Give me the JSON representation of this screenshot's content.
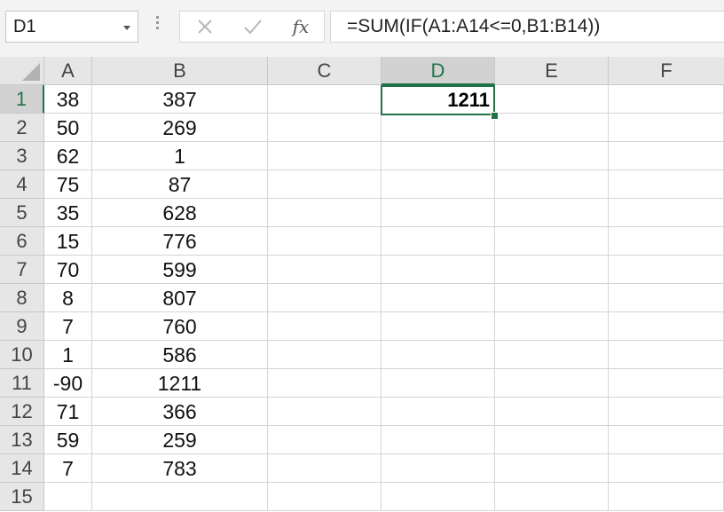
{
  "formula_bar": {
    "name_box": "D1",
    "formula": "=SUM(IF(A1:A14<=0,B1:B14))",
    "function_label": "fx",
    "icons": {
      "cancel": "close-icon",
      "enter": "check-icon",
      "function": "fx-icon"
    }
  },
  "columns": [
    "A",
    "B",
    "C",
    "D",
    "E",
    "F"
  ],
  "rows": [
    "1",
    "2",
    "3",
    "4",
    "5",
    "6",
    "7",
    "8",
    "9",
    "10",
    "11",
    "12",
    "13",
    "14",
    "15"
  ],
  "col_a": [
    "38",
    "50",
    "62",
    "75",
    "35",
    "15",
    "70",
    "8",
    "7",
    "1",
    "-90",
    "71",
    "59",
    "7"
  ],
  "col_b": [
    "387",
    "269",
    "1",
    "87",
    "628",
    "776",
    "599",
    "807",
    "760",
    "586",
    "1211",
    "366",
    "259",
    "783"
  ],
  "active_cell": {
    "ref": "D1",
    "value": "1211"
  },
  "colors": {
    "accent": "#217346",
    "header_bg": "#e6e6e6",
    "selected_header_bg": "#d2d2d2"
  }
}
